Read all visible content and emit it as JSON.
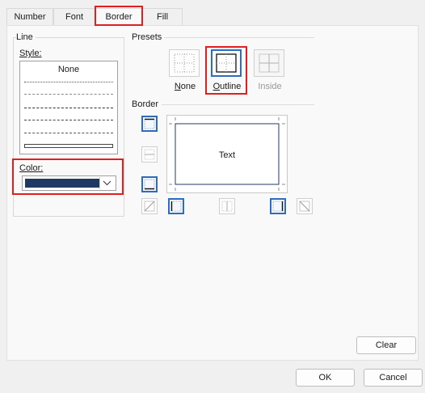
{
  "tabs": [
    {
      "label": "Number"
    },
    {
      "label": "Font"
    },
    {
      "label": "Border"
    },
    {
      "label": "Fill"
    }
  ],
  "line": {
    "group_label": "Line",
    "style_label": "Style:",
    "style_none": "None",
    "color_label": "Color:",
    "color_value": "#1f3864"
  },
  "presets": {
    "group_label": "Presets",
    "items": [
      {
        "label": "None",
        "underline": "N",
        "rest": "one"
      },
      {
        "label": "Outline",
        "underline": "O",
        "rest": "utline"
      },
      {
        "label": "Inside"
      }
    ]
  },
  "border": {
    "group_label": "Border",
    "preview_text": "Text"
  },
  "buttons": {
    "clear_label": "Clear",
    "ok_label": "OK",
    "cancel_label": "Cancel"
  },
  "colors": {
    "highlight": "#e02020",
    "selected_border": "#2e6cc0",
    "line_color": "#1f3864"
  }
}
